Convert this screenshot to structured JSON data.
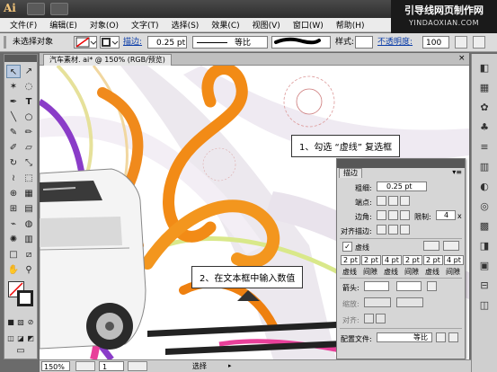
{
  "brand": {
    "line1": "引导线网页制作网",
    "line2": "YINDAOXIAN.COM"
  },
  "app": {
    "logo": "Ai"
  },
  "menu": [
    "文件(F)",
    "编辑(E)",
    "对象(O)",
    "文字(T)",
    "选择(S)",
    "效果(C)",
    "视图(V)",
    "窗口(W)",
    "帮助(H)"
  ],
  "control": {
    "selection_label": "未选择对象",
    "stroke_label": "描边:",
    "stroke_weight": "0.25 pt",
    "profile_label": "等比",
    "style_label": "样式:",
    "opacity_label": "不透明度:",
    "opacity_value": "100"
  },
  "document": {
    "tab_title": "汽车素材. ai* @ 150% (RGB/预览)",
    "close": "×"
  },
  "callouts": {
    "first": "1、勾选 “虚线” 复选框",
    "second": "2、在文本框中输入数值"
  },
  "stroke_panel": {
    "tab": "描边",
    "weight_label": "粗细:",
    "weight_value": "0.25 pt",
    "cap_label": "端点:",
    "corner_label": "边角:",
    "limit_label": "限制:",
    "limit_value": "4",
    "limit_unit": "x",
    "align_label": "对齐描边:",
    "dashed_label": "虚线",
    "dashed_checked": "✓",
    "dash_values": [
      "2 pt",
      "2 pt",
      "4 pt",
      "2 pt",
      "2 pt",
      "4 pt"
    ],
    "dash_labels": [
      "虚线",
      "间隙",
      "虚线",
      "间隙",
      "虚线",
      "间隙"
    ],
    "arrowhead_label": "箭头:",
    "scale_label": "缩放:",
    "align_arrow_label": "对齐:",
    "profile_label": "配置文件:",
    "profile_value": "等比"
  },
  "status": {
    "zoom": "150%",
    "page": "1",
    "tool": "选择"
  },
  "colors": {
    "orange": "#f08a1c",
    "purple": "#8a3cc8",
    "green": "#6cc43a",
    "pink": "#e8409a"
  }
}
